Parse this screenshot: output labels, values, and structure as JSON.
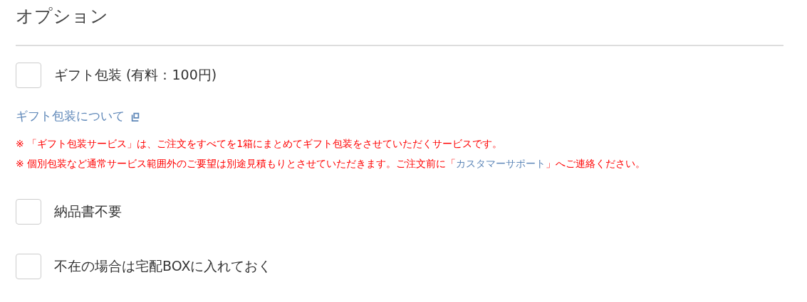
{
  "title": "オプション",
  "gift_option": {
    "label": "ギフト包装 (有料：100円)",
    "checked": false
  },
  "gift_link": "ギフト包装について",
  "notes": [
    {
      "before": "※ 「ギフト包装サービス」は、ご注文をすべてを1箱にまとめてギフト包装をさせていただくサービスです。"
    },
    {
      "before": "※ 個別包装など通常サービス範囲外のご要望は別途見積もりとさせていただきます。ご注文前に「",
      "link": "カスタマーサポート",
      "after": "」へご連絡ください。"
    }
  ],
  "options": [
    {
      "label": "納品書不要",
      "checked": false
    },
    {
      "label": "不在の場合は宅配BOXに入れておく",
      "checked": false
    }
  ]
}
